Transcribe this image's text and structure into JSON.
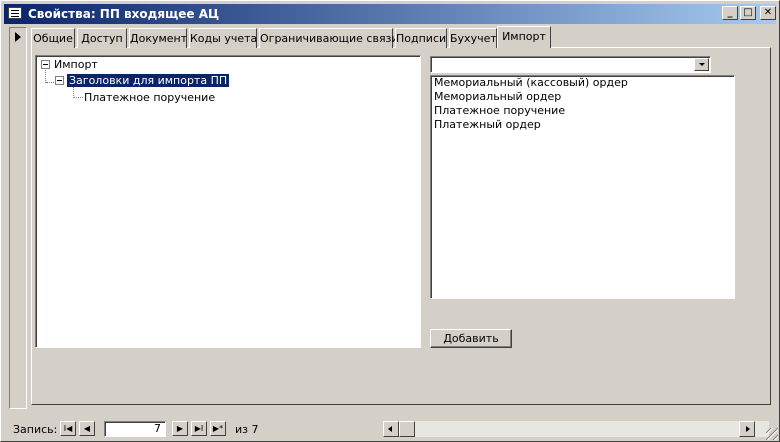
{
  "window": {
    "title": "Свойства: ПП входящее АЦ",
    "minimize_glyph": "_",
    "maximize_glyph": "□",
    "close_glyph": "✕"
  },
  "tabs": [
    {
      "label": "Общие"
    },
    {
      "label": "Доступ"
    },
    {
      "label": "Документ"
    },
    {
      "label": "Коды учета"
    },
    {
      "label": "Ограничивающие связи"
    },
    {
      "label": "Подписи"
    },
    {
      "label": "Бухучет"
    },
    {
      "label": "Импорт"
    }
  ],
  "active_tab": "Импорт",
  "tree": {
    "root": "Импорт",
    "child": "Заголовки для импорта ПП",
    "grandchild": "Платежное поручение"
  },
  "combo": {
    "value": ""
  },
  "list": {
    "items": [
      "Мемориальный (кассовый) ордер",
      "Мемориальный ордер",
      "Платежное поручение",
      "Платежный ордер"
    ]
  },
  "add_button": {
    "label": "Добавить"
  },
  "navigation": {
    "record_label": "Запись:",
    "current": "7",
    "of_text": "из  7",
    "first_glyph": "I◀",
    "prev_glyph": "◀",
    "next_glyph": "▶",
    "last_glyph": "▶I",
    "new_glyph": "▶*"
  }
}
